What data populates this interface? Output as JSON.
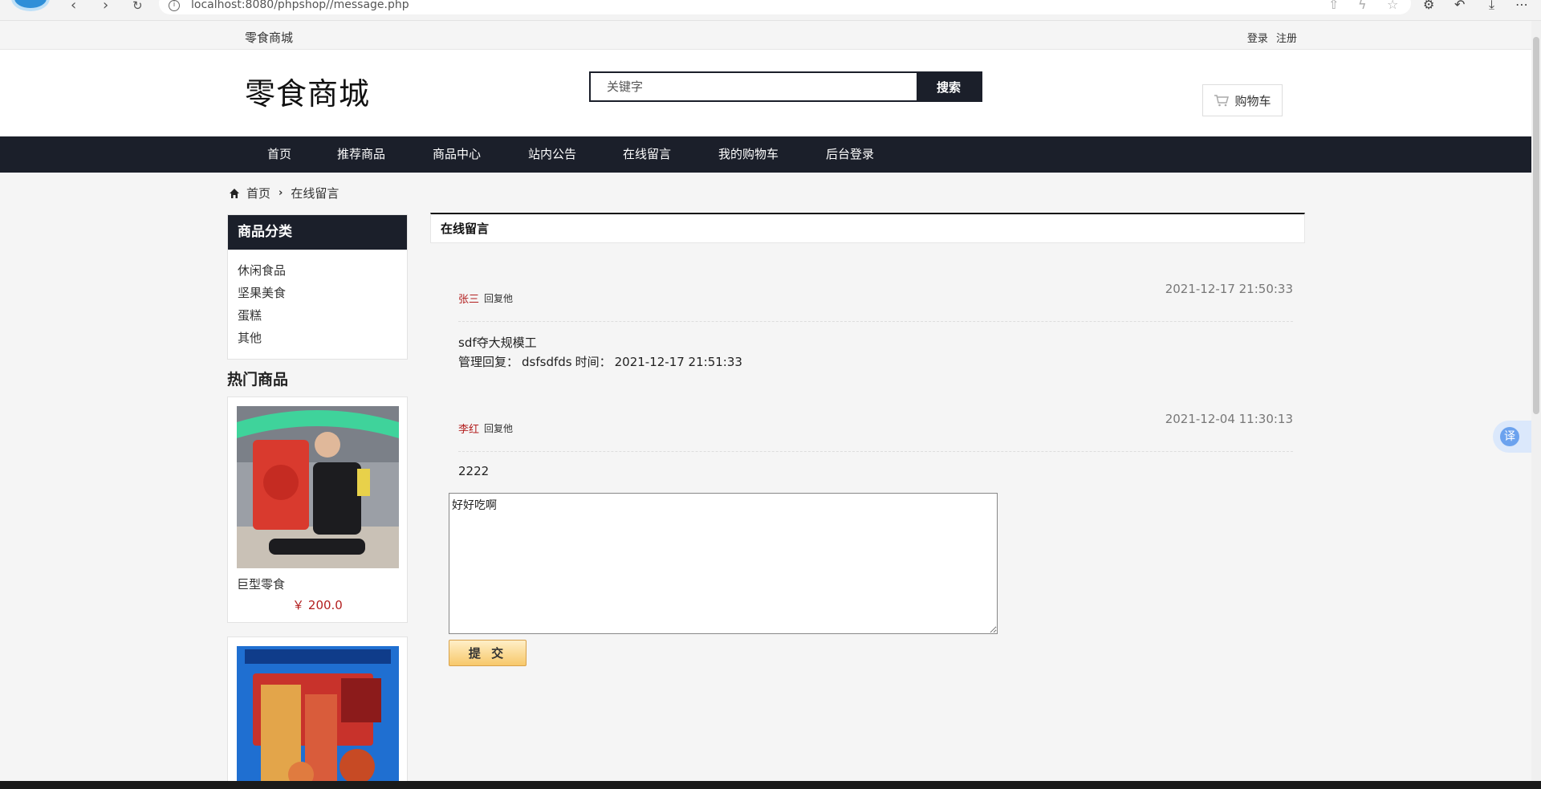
{
  "browser": {
    "url": "localhost:8080/phpshop//message.php",
    "back_icon": "chevron-left-icon",
    "forward_icon": "chevron-right-icon",
    "reload_icon": "reload-icon"
  },
  "topbar": {
    "brand": "零食商城",
    "login": "登录",
    "register": "注册"
  },
  "header": {
    "site_title": "零食商城",
    "search_placeholder": "关键字",
    "search_button": "搜索",
    "cart_label": "购物车"
  },
  "nav": [
    "首页",
    "推荐商品",
    "商品中心",
    "站内公告",
    "在线留言",
    "我的购物车",
    "后台登录"
  ],
  "breadcrumb": {
    "home": "首页",
    "current": "在线留言"
  },
  "sidebar": {
    "category_title": "商品分类",
    "categories": [
      "休闲食品",
      "坚果美食",
      "蛋糕",
      "其他"
    ],
    "hot_title": "热门商品",
    "products": [
      {
        "name": "巨型零食",
        "price": "￥ 200.0"
      }
    ]
  },
  "main": {
    "section_title": "在线留言",
    "messages": [
      {
        "author": "张三",
        "reply_label": "回复他",
        "time": "2021-12-17 21:50:33",
        "content": "sdf夺大规模工",
        "admin_reply_label": "管理回复：",
        "admin_reply": "dsfsdfds",
        "admin_time_label": "时间：",
        "admin_time": "2021-12-17 21:51:33"
      },
      {
        "author": "李红",
        "reply_label": "回复他",
        "time": "2021-12-04 11:30:13",
        "content": "2222"
      }
    ],
    "textarea_value": "好好吃啊",
    "submit_label": "提 交"
  },
  "translate": {
    "label": "译"
  }
}
